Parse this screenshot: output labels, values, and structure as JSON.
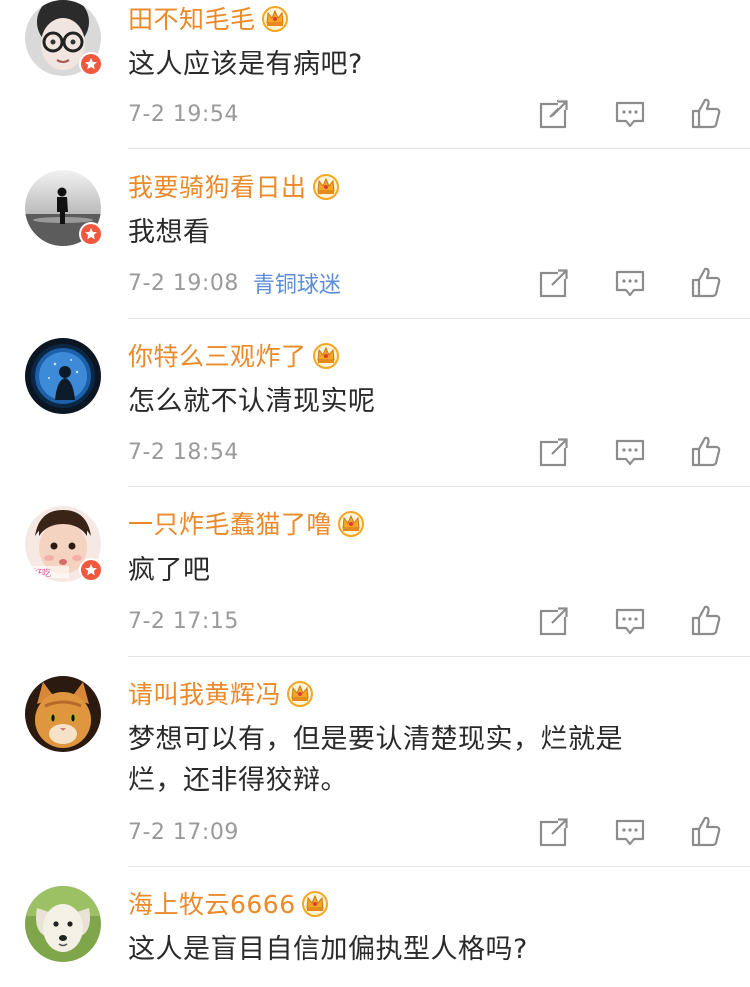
{
  "colors": {
    "username": "#ea8a2b",
    "comment_text": "#2a2a2a",
    "timestamp": "#9a9a9a",
    "medal": "#5b8ed6",
    "vip_badge": "#f1593f",
    "crown": "#f5a623",
    "divider": "#e6e6e6"
  },
  "icons": {
    "share": "share-icon",
    "comment": "comment-icon",
    "like": "like-icon",
    "crown": "crown-icon",
    "verified": "verified-badge-icon"
  },
  "comments": [
    {
      "username": "田不知毛毛",
      "text": "这人应该是有病吧?",
      "time": "7-2 19:54",
      "medal": "",
      "verified": true,
      "avatar": "glasses-child-avatar"
    },
    {
      "username": "我要骑狗看日出",
      "text": "我想看",
      "time": "7-2 19:08",
      "medal": "青铜球迷",
      "verified": true,
      "avatar": "silhouette-sunset-avatar"
    },
    {
      "username": "你特么三观炸了",
      "text": "怎么就不认清现实呢",
      "time": "7-2 18:54",
      "medal": "",
      "verified": false,
      "avatar": "blue-portal-avatar"
    },
    {
      "username": "一只炸毛蠢猫了噜",
      "text": "疯了吧",
      "time": "7-2 17:15",
      "medal": "",
      "verified": true,
      "avatar": "baby-avatar"
    },
    {
      "username": "请叫我黄辉冯",
      "text": "梦想可以有，但是要认清楚现实，烂就是烂，还非得狡辩。",
      "time": "7-2 17:09",
      "medal": "",
      "verified": false,
      "avatar": "orange-cat-avatar"
    },
    {
      "username": "海上牧云6666",
      "text": "这人是盲目自信加偏执型人格吗?",
      "time": "",
      "medal": "",
      "verified": false,
      "avatar": "white-puppy-avatar"
    }
  ]
}
